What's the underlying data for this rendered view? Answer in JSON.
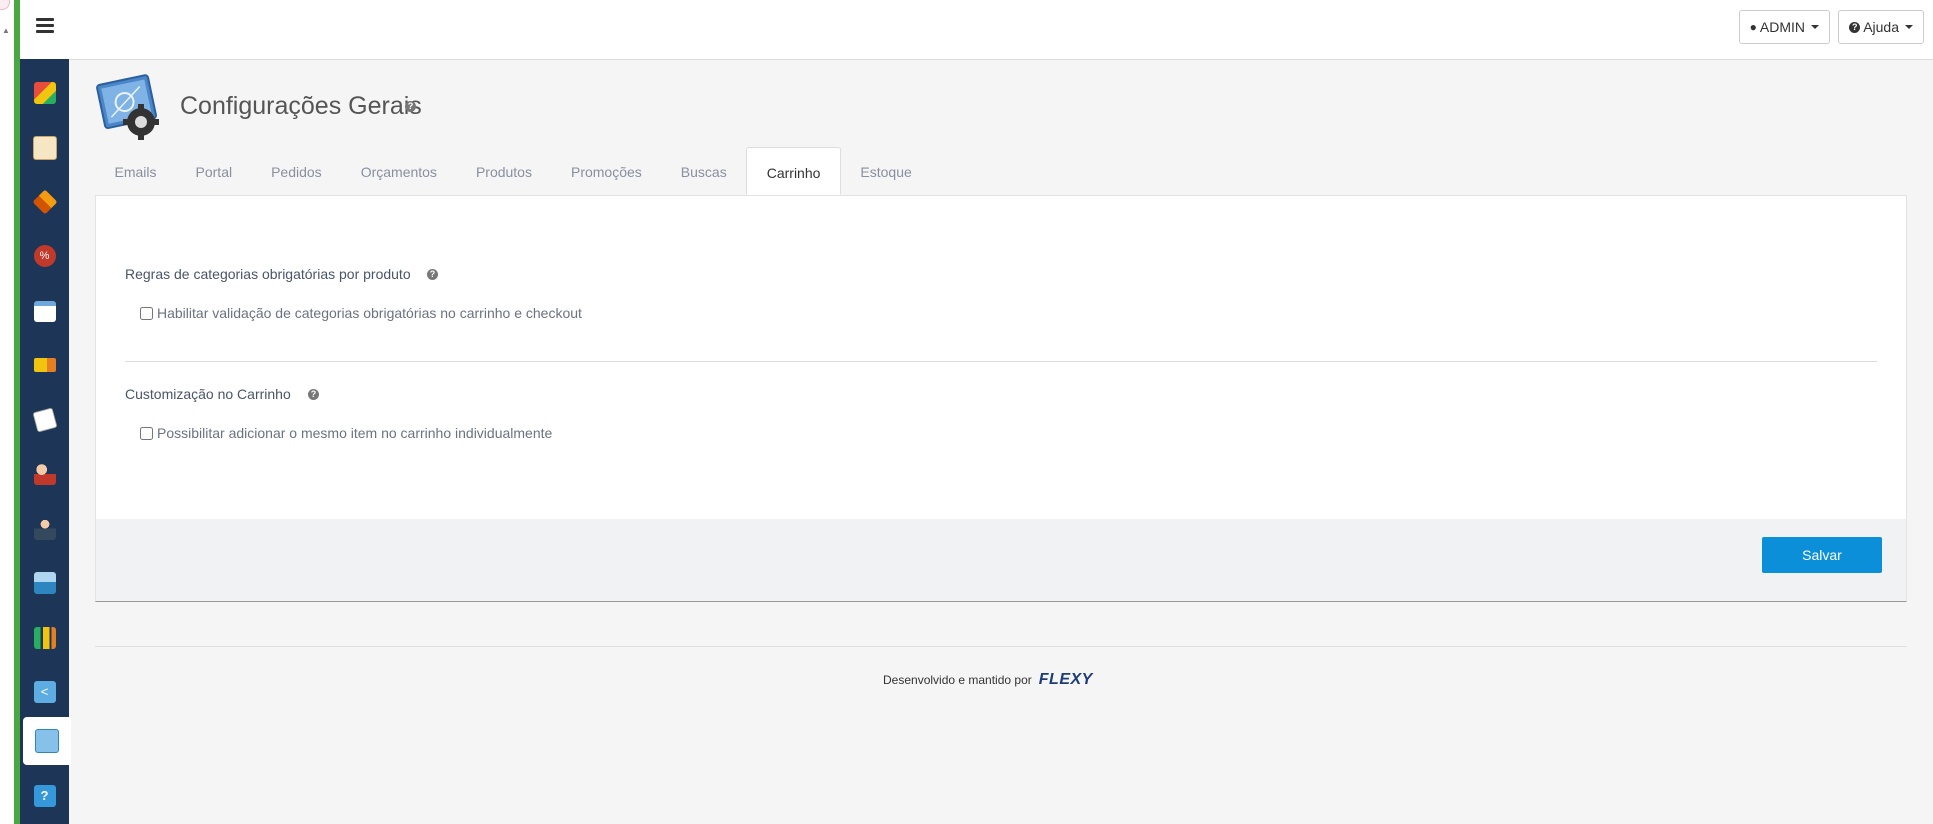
{
  "header": {
    "user_label": "ADMIN",
    "help_label": "Ajuda"
  },
  "page": {
    "title": "Configurações Gerais"
  },
  "tabs": [
    {
      "label": "Emails"
    },
    {
      "label": "Portal"
    },
    {
      "label": "Pedidos"
    },
    {
      "label": "Orçamentos"
    },
    {
      "label": "Produtos"
    },
    {
      "label": "Promoções"
    },
    {
      "label": "Buscas"
    },
    {
      "label": "Carrinho",
      "active": true
    },
    {
      "label": "Estoque"
    }
  ],
  "sections": [
    {
      "title": "Regras de categorias obrigatórias por produto",
      "option_label": "Habilitar validação de categorias obrigatórias no carrinho e checkout",
      "checked": false
    },
    {
      "title": "Customização no Carrinho",
      "option_label": "Possibilitar adicionar o mesmo item no carrinho individualmente",
      "checked": false
    }
  ],
  "actions": {
    "save_label": "Salvar"
  },
  "footer": {
    "text": "Desenvolvido e mantido por",
    "brand": "FLEXY"
  },
  "sidebar": {
    "icons": [
      "products-box-icon",
      "catalog-icon",
      "packages-icon",
      "discount-icon",
      "card-icon",
      "delivery-truck-icon",
      "documents-icon",
      "customers-icon",
      "user-icon",
      "store-icon",
      "reports-icon",
      "share-icon",
      "settings-icon",
      "help-icon"
    ],
    "active_index": 12
  },
  "colors": {
    "accent": "#0b8fd9",
    "sidebar": "#1d3557",
    "green_bar": "#4aa843"
  }
}
